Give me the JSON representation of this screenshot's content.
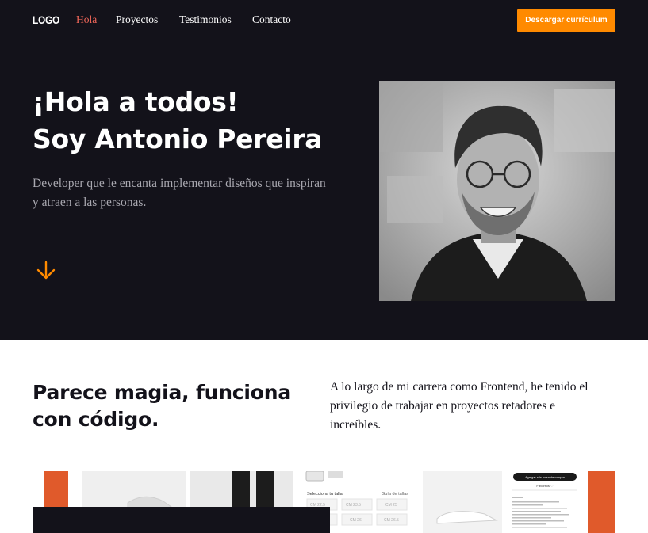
{
  "header": {
    "logo": "LOGO",
    "nav": [
      {
        "label": "Hola",
        "active": true
      },
      {
        "label": "Proyectos",
        "active": false
      },
      {
        "label": "Testimonios",
        "active": false
      },
      {
        "label": "Contacto",
        "active": false
      }
    ],
    "cta_label": "Descargar currículum"
  },
  "hero": {
    "title_line1": "¡Hola a todos!",
    "title_line2": "Soy Antonio Pereira",
    "subtitle": "Developer que le encanta implementar diseños que inspiran y atraen a las personas.",
    "scroll_icon": "arrow-down-icon"
  },
  "intro": {
    "title_line1": "Parece magia, funciona",
    "title_line2": "con código.",
    "text": "A lo largo de mi carrera como Frontend, he tenido el privilegio de trabajar en proyectos retadores e increíbles."
  },
  "projects_preview": {
    "size_label": "Selecciona tu talla",
    "size_guide": "Guía de tallas",
    "sizes": [
      "CM 22.5",
      "CM 23.5",
      "CM 25",
      "",
      "CM 26",
      "CM 26.5"
    ],
    "cart_button": "Agregar a la bolsa de compra",
    "favorites": "Favoritos ♡"
  },
  "colors": {
    "dark": "#13121a",
    "accent": "#ff8a00",
    "active_link": "#f4685a",
    "project_orange": "#e05a2b"
  }
}
